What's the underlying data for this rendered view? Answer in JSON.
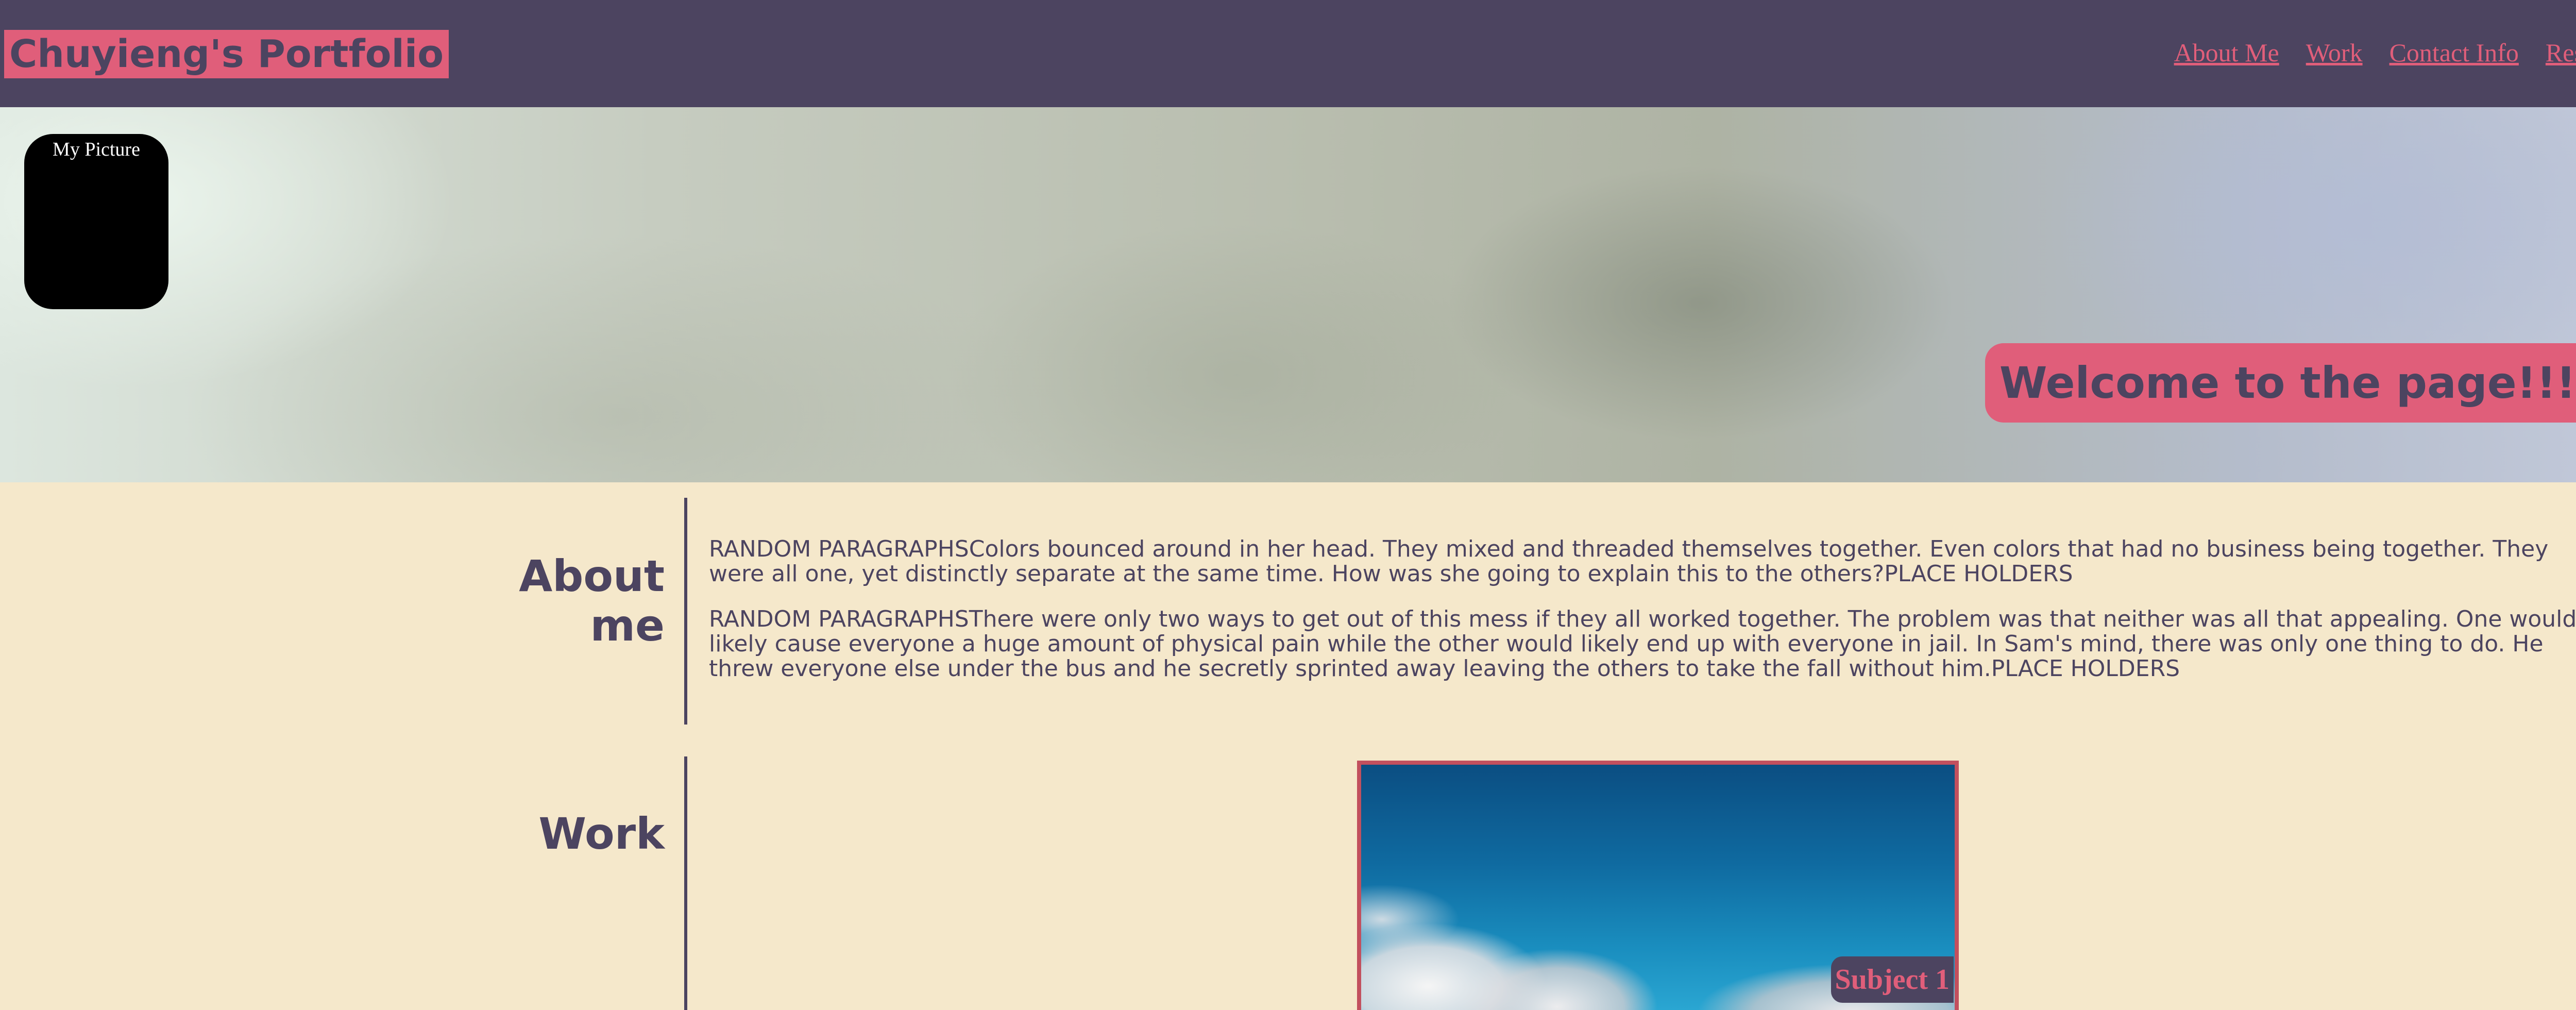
{
  "header": {
    "brand": "Chuyieng's Portfolio",
    "nav": [
      {
        "label": "About Me"
      },
      {
        "label": "Work"
      },
      {
        "label": "Contact Info"
      },
      {
        "label": "Resume"
      }
    ]
  },
  "banner": {
    "picture_label": "My Picture",
    "welcome": "Welcome to the page!!!!"
  },
  "about": {
    "title": "About me",
    "paragraphs": [
      "RANDOM PARAGRAPHSColors bounced around in her head. They mixed and threaded themselves together. Even colors that had no business being together. They were all one, yet distinctly separate at the same time. How was she going to explain this to the others?PLACE HOLDERS",
      "RANDOM PARAGRAPHSThere were only two ways to get out of this mess if they all worked together. The problem was that neither was all that appealing. One would likely cause everyone a huge amount of physical pain while the other would likely end up with everyone in jail. In Sam's mind, there was only one thing to do. He threw everyone else under the bus and he secretly sprinted away leaving the others to take the fall without him.PLACE HOLDERS"
    ]
  },
  "work": {
    "title": "Work",
    "items": [
      {
        "label": "Subject 1"
      }
    ]
  },
  "colors": {
    "header_bg": "#4C4460",
    "accent": "#E05E7A",
    "page_bg": "#F5E8CB",
    "card_border": "#C2505E"
  }
}
